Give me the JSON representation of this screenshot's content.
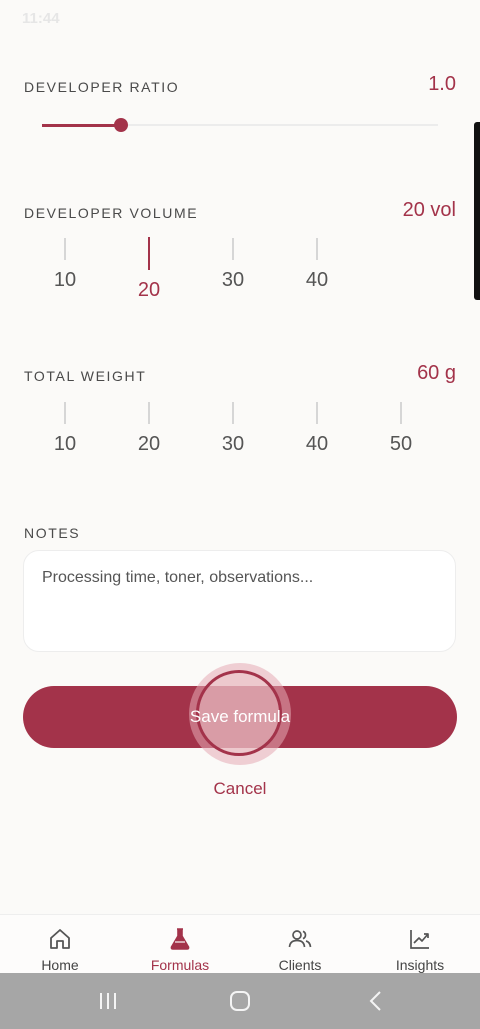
{
  "status": {
    "time": "11:44",
    "right": ""
  },
  "ratio": {
    "label": "DEVELOPER RATIO",
    "value": "1.0",
    "fraction": 0.2
  },
  "volume": {
    "label": "DEVELOPER VOLUME",
    "value": "20 vol",
    "ticks": [
      "10",
      "20",
      "30",
      "40"
    ],
    "selected_index": 1
  },
  "weight": {
    "label": "TOTAL WEIGHT",
    "value": "60 g",
    "ticks": [
      "10",
      "20",
      "30",
      "40",
      "50"
    ]
  },
  "notes": {
    "label": "NOTES",
    "placeholder": "Processing time, toner, observations..."
  },
  "actions": {
    "save": "Save formula",
    "cancel": "Cancel"
  },
  "nav": {
    "items": [
      {
        "label": "Home",
        "icon": "home-icon"
      },
      {
        "label": "Formulas",
        "icon": "flask-icon",
        "active": true
      },
      {
        "label": "Clients",
        "icon": "users-icon"
      },
      {
        "label": "Insights",
        "icon": "chart-icon"
      }
    ]
  },
  "colors": {
    "accent": "#a3334a",
    "background": "#fbfaf8"
  }
}
